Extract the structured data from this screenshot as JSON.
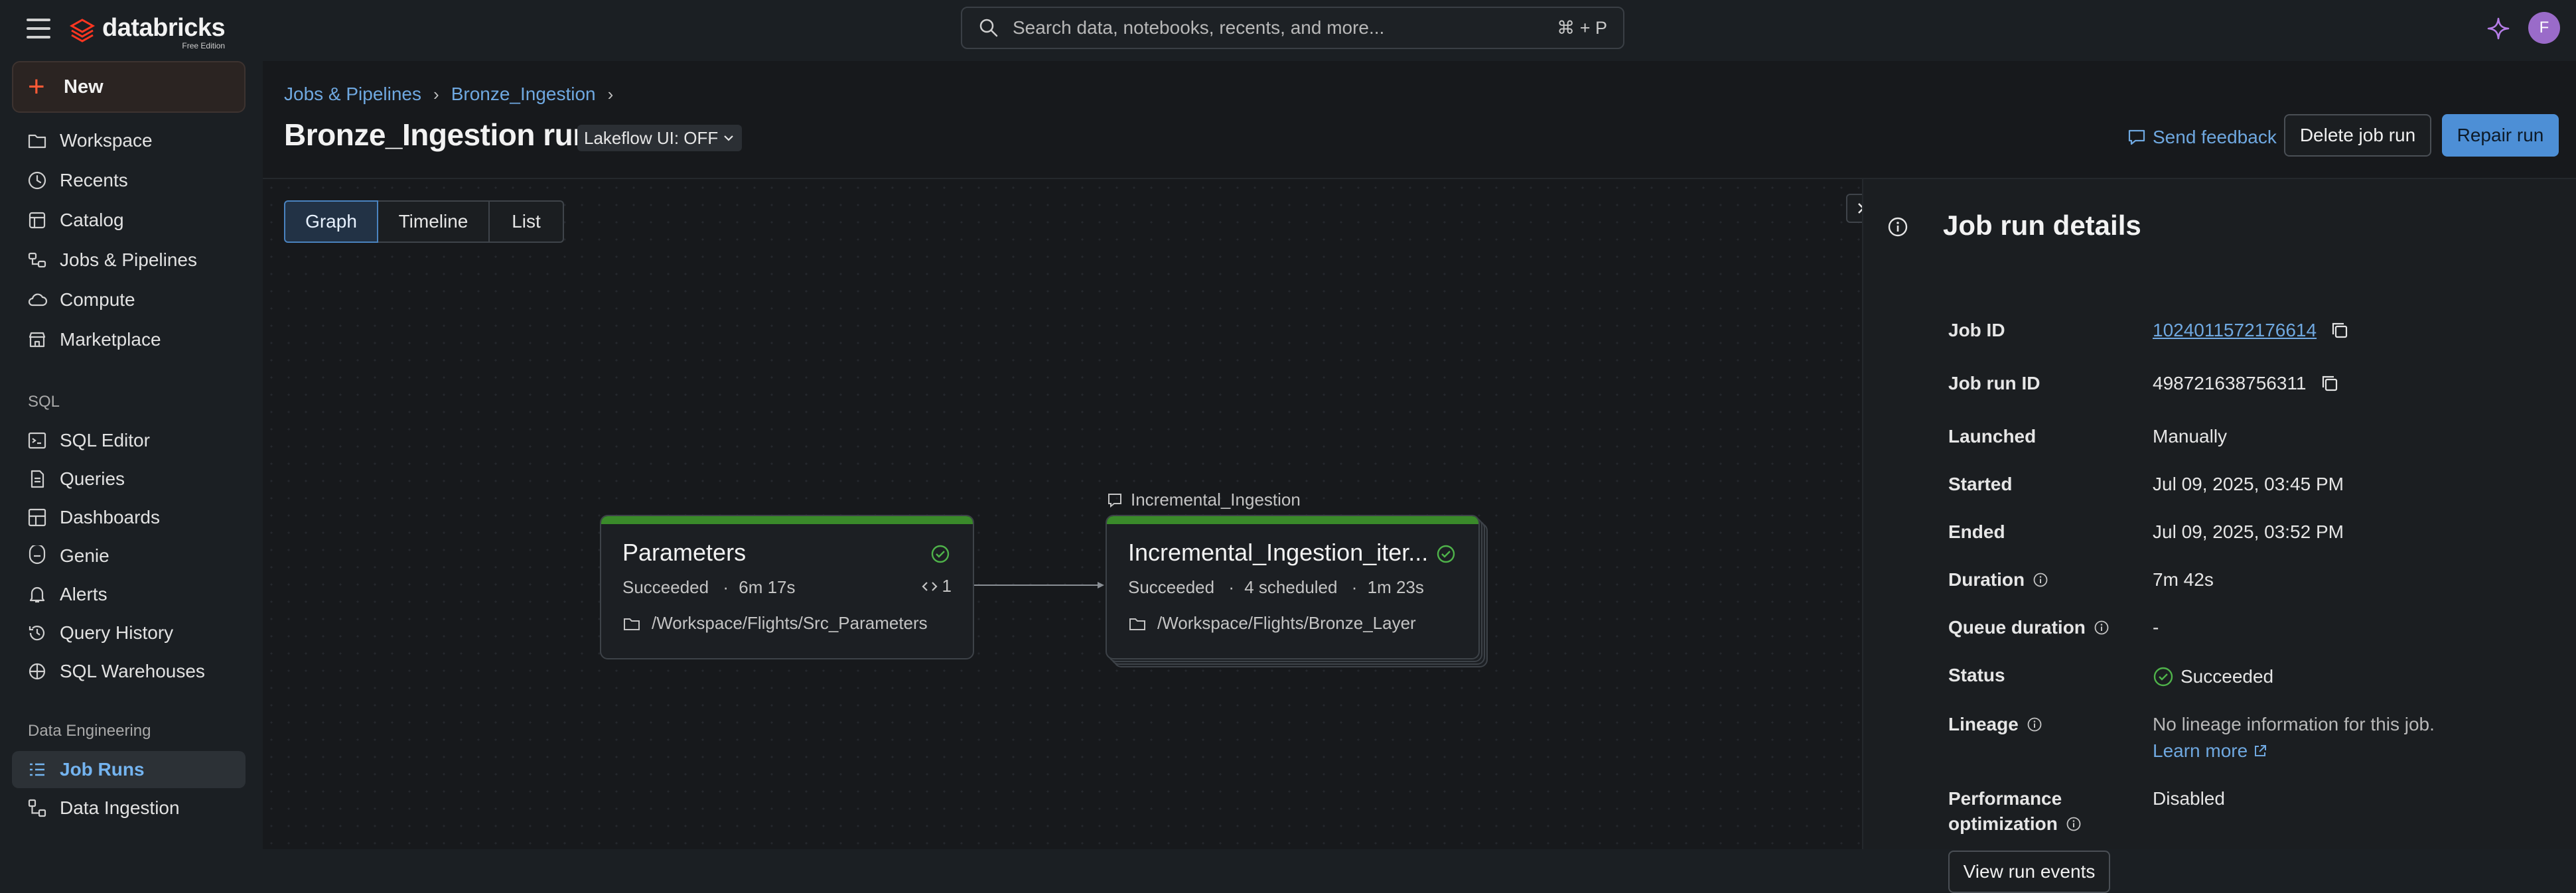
{
  "brand": {
    "name": "databricks",
    "edition": "Free Edition",
    "color": "#ff3621"
  },
  "search": {
    "placeholder": "Search data, notebooks, recents, and more...",
    "shortcut": "⌘ + P"
  },
  "user": {
    "initial": "F",
    "avatar_color": "#9a6bc9"
  },
  "sidebar": {
    "new_label": "New",
    "items": [
      {
        "label": "Workspace",
        "icon": "workspace-icon"
      },
      {
        "label": "Recents",
        "icon": "clock-icon"
      },
      {
        "label": "Catalog",
        "icon": "catalog-icon"
      },
      {
        "label": "Jobs & Pipelines",
        "icon": "jobs-icon"
      },
      {
        "label": "Compute",
        "icon": "cloud-icon"
      },
      {
        "label": "Marketplace",
        "icon": "store-icon"
      }
    ],
    "sql_section": "SQL",
    "sql_items": [
      {
        "label": "SQL Editor",
        "icon": "sql-editor-icon"
      },
      {
        "label": "Queries",
        "icon": "query-icon"
      },
      {
        "label": "Dashboards",
        "icon": "dashboard-icon"
      },
      {
        "label": "Genie",
        "icon": "genie-icon"
      },
      {
        "label": "Alerts",
        "icon": "bell-icon"
      },
      {
        "label": "Query History",
        "icon": "history-icon"
      },
      {
        "label": "SQL Warehouses",
        "icon": "warehouse-icon"
      }
    ],
    "de_section": "Data Engineering",
    "de_items": [
      {
        "label": "Job Runs",
        "icon": "job-runs-icon",
        "active": true
      },
      {
        "label": "Data Ingestion",
        "icon": "ingestion-icon"
      }
    ]
  },
  "breadcrumb": [
    "Jobs & Pipelines",
    "Bronze_Ingestion"
  ],
  "page": {
    "title": "Bronze_Ingestion run",
    "lakeflow_label": "Lakeflow UI: OFF",
    "send_feedback": "Send feedback",
    "delete_label": "Delete job run",
    "repair_label": "Repair run"
  },
  "view_tabs": {
    "selected": "Graph",
    "tabs": [
      "Graph",
      "Timeline",
      "List"
    ]
  },
  "graph": {
    "tasks": [
      {
        "title": "Parameters",
        "status": "Succeeded",
        "duration": "6m 17s",
        "param_count": "1",
        "path": "/Workspace/Flights/Src_Parameters"
      },
      {
        "foreach_label": "Incremental_Ingestion",
        "title": "Incremental_Ingestion_iter...",
        "status": "Succeeded",
        "scheduled": "4 scheduled",
        "duration": "1m 23s",
        "path": "/Workspace/Flights/Bronze_Layer"
      }
    ],
    "status_color": "#3a8a2a"
  },
  "details": {
    "title": "Job run details",
    "fields": {
      "job_id_label": "Job ID",
      "job_id": "1024011572176614",
      "run_id_label": "Job run ID",
      "run_id": "498721638756311",
      "launched_label": "Launched",
      "launched": "Manually",
      "started_label": "Started",
      "started": "Jul 09, 2025, 03:45 PM",
      "ended_label": "Ended",
      "ended": "Jul 09, 2025, 03:52 PM",
      "duration_label": "Duration",
      "duration": "7m 42s",
      "queue_label": "Queue duration",
      "queue": "-",
      "status_label": "Status",
      "status": "Succeeded",
      "lineage_label": "Lineage",
      "lineage": "No lineage information for this job.",
      "learn_more": "Learn more",
      "perf_label_1": "Performance",
      "perf_label_2": "optimization",
      "perf": "Disabled"
    },
    "view_events": "View run events"
  }
}
